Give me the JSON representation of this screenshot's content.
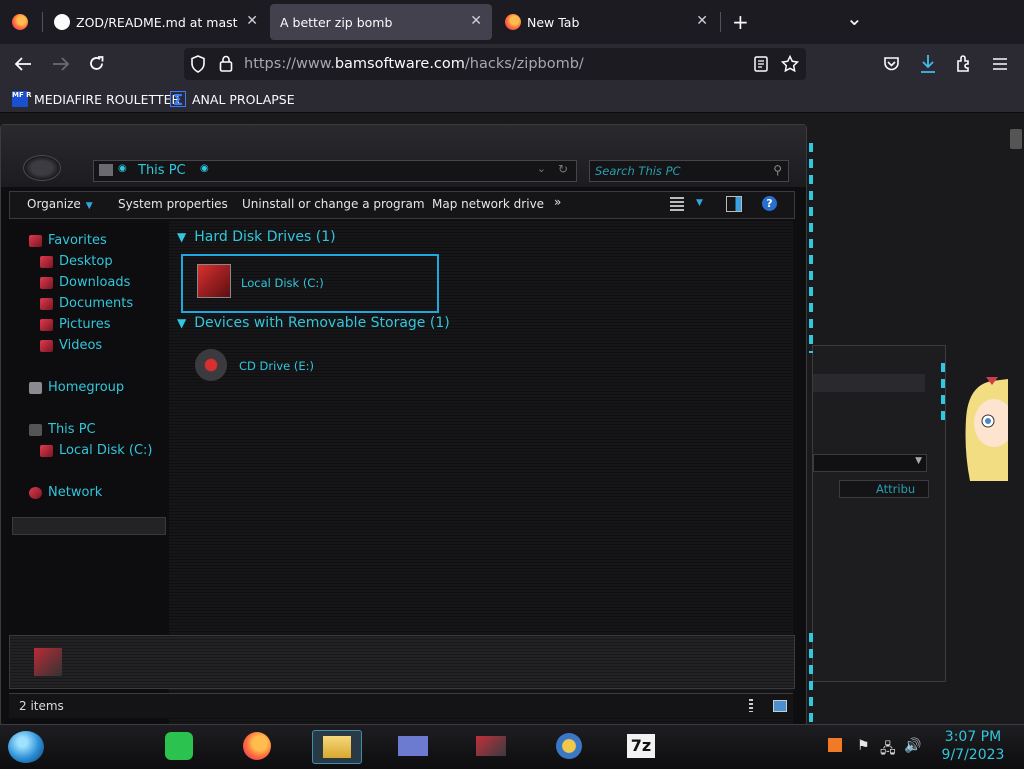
{
  "browser": {
    "tabs": [
      {
        "label": "ZOD/README.md at master · io",
        "close": "✕"
      },
      {
        "label": "A better zip bomb",
        "close": "✕"
      },
      {
        "label": "New Tab",
        "close": "✕"
      }
    ],
    "new_tab": "+",
    "list_all_tabs": "⌄",
    "url": {
      "scheme_prefix": "https://www.",
      "host": "bamsoftware.com",
      "path": "/hacks/zipbomb/"
    },
    "bookmarks": [
      {
        "label": "MEDIAFIRE ROULETTER",
        "icon_text": "MF R"
      },
      {
        "label": "ANAL PROLAPSE",
        "icon_text": "Σ"
      }
    ]
  },
  "explorer": {
    "address": "This PC",
    "search_placeholder": "Search This PC",
    "commands": {
      "organize": "Organize",
      "system_properties": "System properties",
      "uninstall": "Uninstall or change a program",
      "map_drive": "Map network drive",
      "more": "»"
    },
    "nav": {
      "favorites": "Favorites",
      "desktop": "Desktop",
      "downloads": "Downloads",
      "documents": "Documents",
      "pictures": "Pictures",
      "videos": "Videos",
      "homegroup": "Homegroup",
      "this_pc": "This PC",
      "local_disk": "Local Disk (C:)",
      "network": "Network"
    },
    "groups": {
      "hdd": "Hard Disk Drives (1)",
      "removable": "Devices with Removable Storage (1)"
    },
    "items": {
      "local_disk": "Local Disk (C:)",
      "cd_drive": "CD Drive (E:)"
    },
    "status": "2 items",
    "partial_column": "Attribu"
  },
  "taskbar": {
    "time": "3:07 PM",
    "date": "9/7/2023",
    "app_7zip": "7z"
  },
  "colors": {
    "accent": "#2ec8e0",
    "selection": "#1ea8e0",
    "chrome": "#2b2a33"
  }
}
